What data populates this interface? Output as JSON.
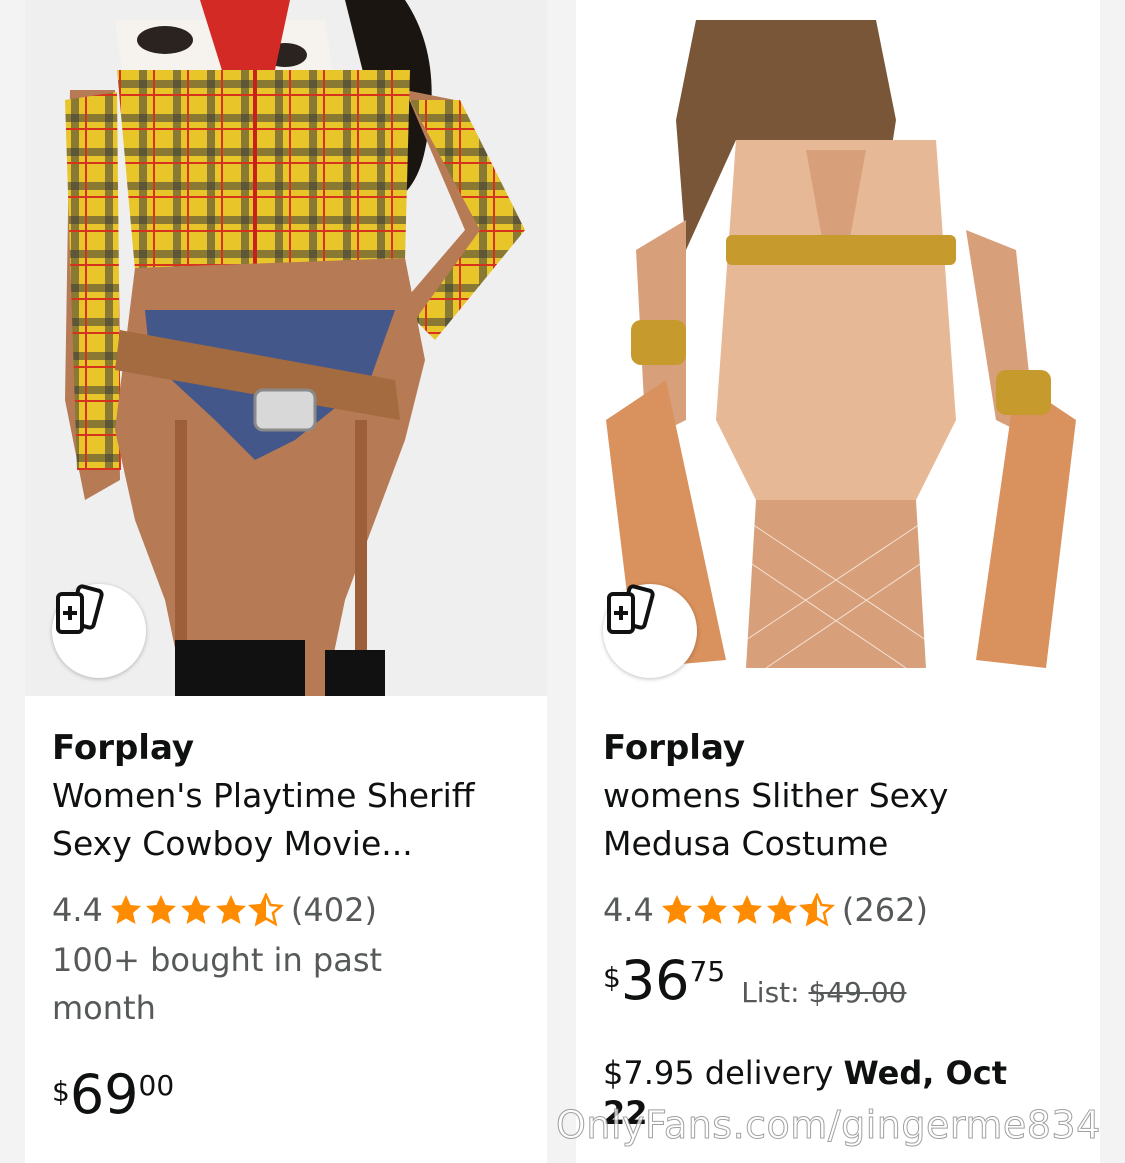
{
  "products": [
    {
      "brand": "Forplay",
      "title_line1": "Women's Playtime Sheriff",
      "title_line2": "Sexy Cowboy Movie...",
      "rating": "4.4",
      "reviews": "(402)",
      "bought_line1": "100+ bought in past",
      "bought_line2": "month",
      "price_currency": "$",
      "price_whole": "69",
      "price_fraction": "00",
      "compare_icon": "compare-cards-icon",
      "outfit_colors": {
        "plaid": "#e8c62a",
        "denim": "#44578a",
        "belt": "#a36b3f"
      }
    },
    {
      "brand": "Forplay",
      "title_line1": "womens Slither Sexy",
      "title_line2": "Medusa Costume",
      "rating": "4.4",
      "reviews": "(262)",
      "price_currency": "$",
      "price_whole": "36",
      "price_fraction": "75",
      "list_label": "List:",
      "list_price": "$49.00",
      "delivery_prefix": "$7.95 delivery",
      "delivery_date": "Wed, Oct",
      "delivery_day": "22",
      "compare_icon": "compare-cards-icon",
      "outfit_colors": {
        "snake": "#e7b896",
        "gold": "#c79a2e"
      }
    }
  ],
  "watermark": "OnlyFans.com/gingerme834",
  "colors": {
    "star": "#ff8c00",
    "text": "#0f1111",
    "muted": "#565959"
  }
}
